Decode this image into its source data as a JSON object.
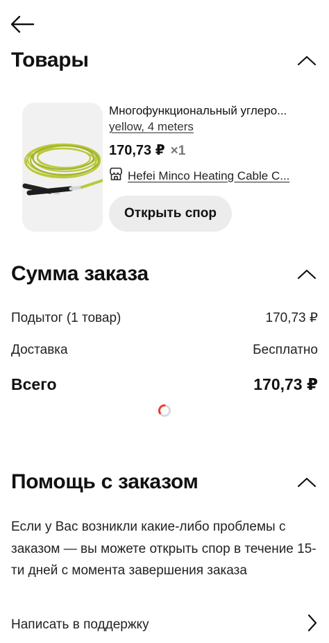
{
  "nav": {
    "back_icon": "arrow-left-icon"
  },
  "products_section": {
    "title": "Товары",
    "collapse_icon": "chevron-up-icon",
    "item": {
      "title": "Многофункциональный углеро...",
      "variant": "yellow, 4 meters",
      "price": "170,73 ₽",
      "quantity": "×1",
      "store_icon": "store-icon",
      "store_name": "Hefei Minco Heating Cable C...",
      "image_description": "yellow-green cable coil",
      "dispute_button": "Открыть спор"
    }
  },
  "summary_section": {
    "title": "Сумма заказа",
    "collapse_icon": "chevron-up-icon",
    "subtotal_label": "Подытог (1 товар)",
    "subtotal_value": "170,73 ₽",
    "delivery_label": "Доставка",
    "delivery_value": "Бесплатно",
    "total_label": "Всего",
    "total_value": "170,73 ₽",
    "loading_icon": "loading-spinner-icon"
  },
  "help_section": {
    "title": "Помощь с заказом",
    "collapse_icon": "chevron-up-icon",
    "text": "Если у Вас возникли какие-либо проблемы с заказом — вы можете открыть спор в течение 15-ти дней с момента завершения заказа",
    "support_link": "Написать в поддержку",
    "support_icon": "chevron-right-icon"
  },
  "colors": {
    "accent": "#e8402f",
    "button_bg": "#ececec",
    "text": "#111111"
  }
}
